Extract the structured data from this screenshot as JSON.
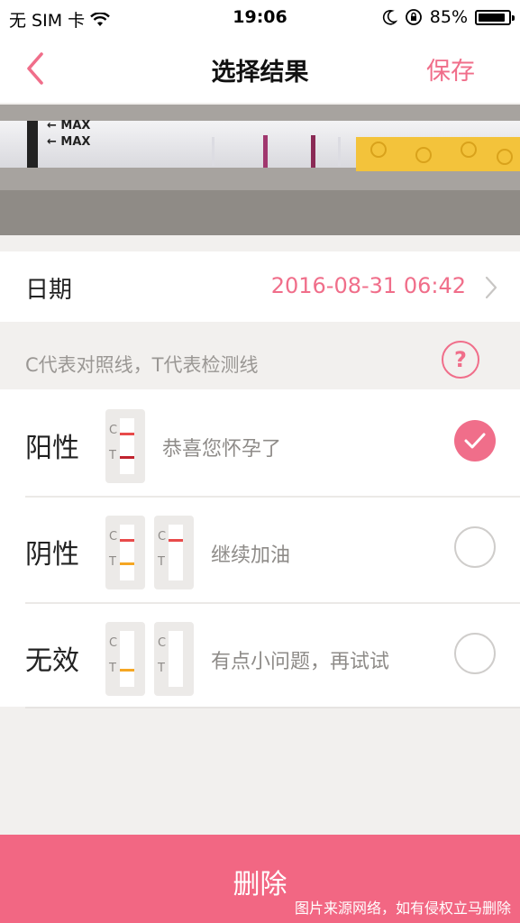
{
  "status_bar": {
    "carrier": "无 SIM 卡",
    "time": "19:06",
    "battery_percent": "85%",
    "battery_level": 0.85
  },
  "nav": {
    "title": "选择结果",
    "save_label": "保存"
  },
  "date": {
    "label": "日期",
    "value": "2016-08-31 06:42"
  },
  "hint": {
    "text": "C代表对照线，T代表检测线",
    "help_symbol": "?"
  },
  "options": [
    {
      "label": "阳性",
      "desc": "恭喜您怀孕了",
      "selected": true
    },
    {
      "label": "阴性",
      "desc": "继续加油",
      "selected": false
    },
    {
      "label": "无效",
      "desc": "有点小问题，再试试",
      "selected": false
    }
  ],
  "strip_letters": {
    "c": "C",
    "t": "T"
  },
  "photo_text": {
    "max1": "← MAX",
    "max2": "← MAX"
  },
  "delete_label": "删除",
  "watermark": "图片来源网络，如有侵权立马删除",
  "colors": {
    "accent": "#f06e8a",
    "delete": "#f26783",
    "line_red": "#e84a4a",
    "line_darkred": "#c0232e",
    "line_orange": "#f5a623"
  }
}
